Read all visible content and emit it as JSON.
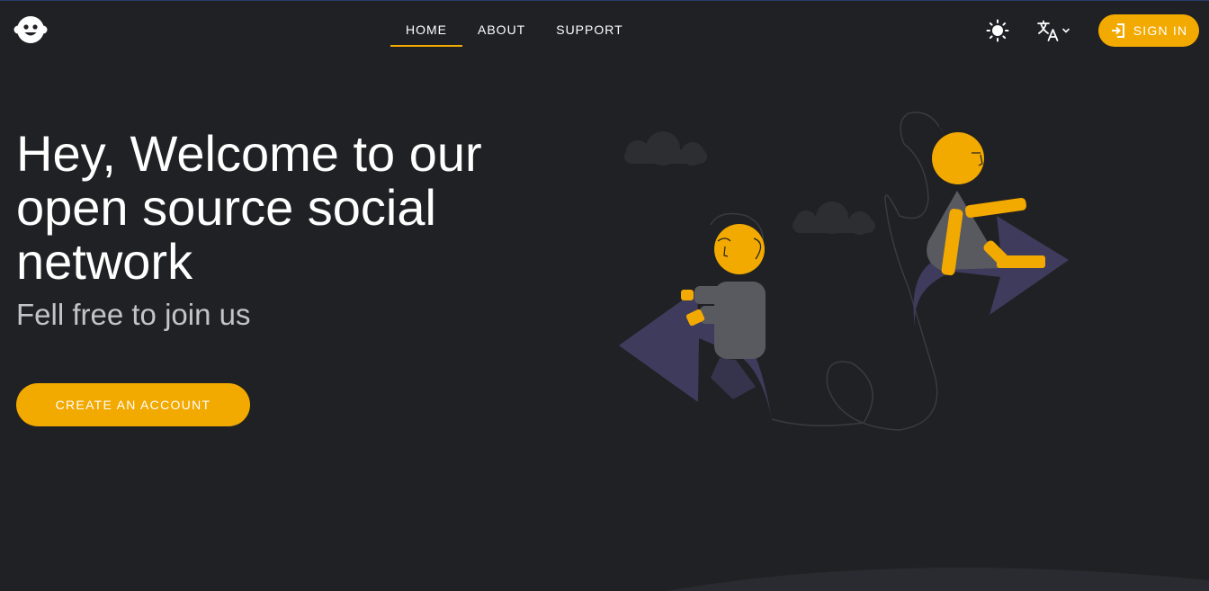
{
  "header": {
    "logo_icon": "robot-face-icon",
    "nav": [
      {
        "label": "HOME",
        "active": true
      },
      {
        "label": "ABOUT",
        "active": false
      },
      {
        "label": "SUPPORT",
        "active": false
      }
    ],
    "theme_icon": "sun-icon",
    "language_icon": "translate-icon",
    "signin_label": "SIGN IN",
    "signin_icon": "login-icon"
  },
  "hero": {
    "title": "Hey, Welcome to our open source social network",
    "subtitle": "Fell free to join us",
    "cta_label": "CREATE AN ACCOUNT"
  },
  "colors": {
    "background": "#202124",
    "accent": "#f2a900",
    "arrow": "#3f3b5c",
    "body_gray": "#595a60"
  }
}
